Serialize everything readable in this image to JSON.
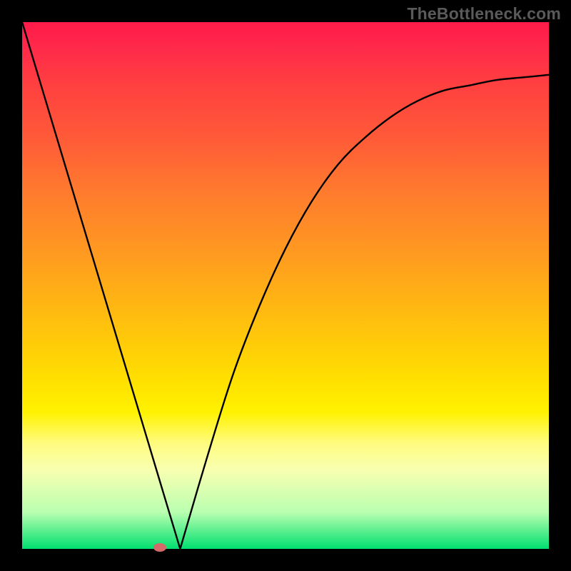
{
  "watermark": "TheBottleneck.com",
  "chart_data": {
    "type": "line",
    "title": "",
    "xlabel": "",
    "ylabel": "",
    "x": [
      0.0,
      0.05,
      0.1,
      0.15,
      0.2,
      0.25,
      0.3,
      0.35,
      0.4,
      0.45,
      0.5,
      0.55,
      0.6,
      0.65,
      0.7,
      0.75,
      0.8,
      0.85,
      0.9,
      0.95,
      1.0
    ],
    "values": [
      1.0,
      0.81,
      0.62,
      0.43,
      0.24,
      0.05,
      0.0,
      0.17,
      0.33,
      0.46,
      0.57,
      0.66,
      0.73,
      0.78,
      0.82,
      0.85,
      0.87,
      0.88,
      0.89,
      0.895,
      0.9
    ],
    "ylim": [
      0,
      1
    ],
    "xlim": [
      0,
      1
    ],
    "marker": {
      "x": 0.261,
      "y": 0.0
    },
    "background_gradient": [
      "#ff1a4a",
      "#ff9a20",
      "#fff200",
      "#00e070"
    ]
  }
}
